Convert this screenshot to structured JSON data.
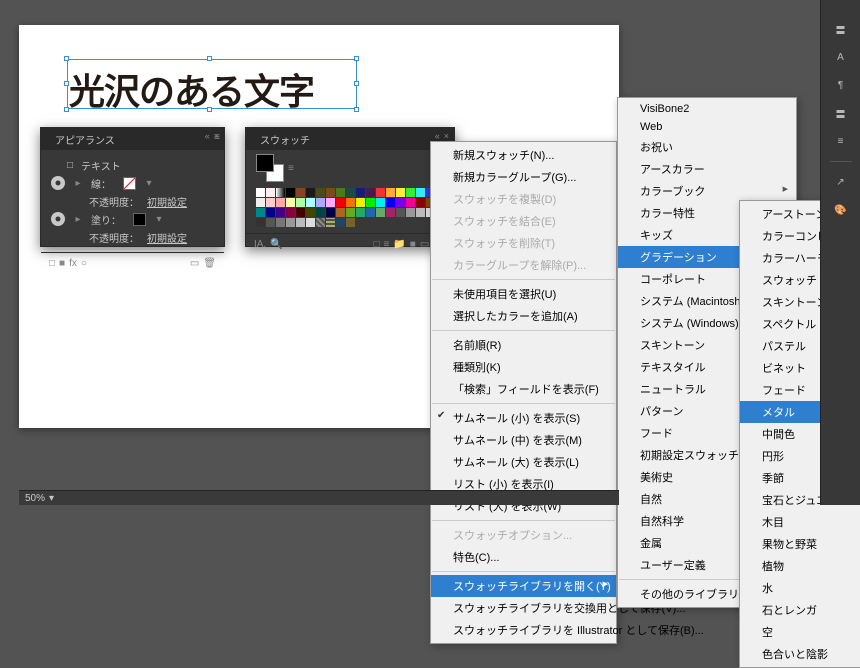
{
  "canvas_text": "光沢のある文字",
  "appearance": {
    "title": "アピアランス",
    "text_mode": "テキスト",
    "rows": [
      {
        "label": "線：",
        "swatch_bg": "linear-gradient(135deg,#fff 45%,#e33 46%,#e33 53%,#fff 54%)"
      },
      {
        "label": "不透明度：",
        "value": "初期設定"
      },
      {
        "label": "塗り：",
        "swatch_bg": "#000"
      },
      {
        "label": "不透明度：",
        "value": "初期設定"
      }
    ],
    "foot_icons": [
      "□",
      "■",
      "fx",
      "○",
      "▭",
      "🗑"
    ]
  },
  "swatches": {
    "title": "スウォッチ",
    "rows": [
      [
        "#fff",
        "#fee",
        "lg",
        "#000",
        "#842",
        "#1a1a1a",
        "#4a4a1a",
        "#7a4a1a",
        "#4a7a1a",
        "#1a4a4a",
        "#1a1a7a",
        "#4a1a4a",
        "#e33",
        "#fa3",
        "#fe3",
        "#3e3",
        "#3ee",
        "#33e",
        "#e3e",
        "#e37"
      ],
      [
        "#eee",
        "#fcc",
        "#faa",
        "#ffa",
        "#afa",
        "#aff",
        "#aaf",
        "#faf",
        "#e00",
        "#e70",
        "#ee0",
        "#0e0",
        "#0ee",
        "#00e",
        "#70e",
        "#e09",
        "#800",
        "#840",
        "#880",
        "#080"
      ],
      [
        "#088",
        "#008",
        "#408",
        "#804",
        "#400",
        "#440",
        "#044",
        "#004",
        "#a62",
        "#6a2",
        "#2a6",
        "#26a",
        "#6a6",
        "#a26",
        "#555",
        "#999",
        "#bbb",
        "#ddd",
        "#000",
        "#fff"
      ],
      [
        "#333",
        "#555",
        "#777",
        "#999",
        "#bbb",
        "#ddd",
        "p1",
        "p2",
        "#246",
        "#762",
        "",
        "",
        "",
        "",
        "",
        "",
        "",
        "",
        "",
        ""
      ]
    ],
    "foot_icons": [
      "IA.",
      "🔍",
      "□",
      "≡",
      "📁",
      "■",
      "▭",
      "🗑"
    ]
  },
  "menu1": {
    "groups": [
      [
        {
          "t": "新規スウォッチ(N)..."
        },
        {
          "t": "新規カラーグループ(G)..."
        },
        {
          "t": "スウォッチを複製(D)",
          "dis": true
        },
        {
          "t": "スウォッチを結合(E)",
          "dis": true
        },
        {
          "t": "スウォッチを削除(T)",
          "dis": true
        },
        {
          "t": "カラーグループを解除(P)...",
          "dis": true
        }
      ],
      [
        {
          "t": "未使用項目を選択(U)"
        },
        {
          "t": "選択したカラーを追加(A)"
        }
      ],
      [
        {
          "t": "名前順(R)"
        },
        {
          "t": "種類別(K)"
        },
        {
          "t": "「検索」フィールドを表示(F)"
        }
      ],
      [
        {
          "t": "サムネール (小) を表示(S)",
          "check": true
        },
        {
          "t": "サムネール (中) を表示(M)"
        },
        {
          "t": "サムネール (大) を表示(L)"
        },
        {
          "t": "リスト (小) を表示(I)"
        },
        {
          "t": "リスト (大) を表示(W)"
        }
      ],
      [
        {
          "t": "スウォッチオプション...",
          "dis": true
        },
        {
          "t": "特色(C)..."
        }
      ],
      [
        {
          "t": "スウォッチライブラリを開く(Y)",
          "hl": true,
          "arrow": true
        },
        {
          "t": "スウォッチライブラリを交換用として保存(V)..."
        },
        {
          "t": "スウォッチライブラリを Illustrator として保存(B)..."
        }
      ]
    ]
  },
  "menu2": {
    "items": [
      {
        "t": "VisiBone2"
      },
      {
        "t": "Web"
      },
      {
        "t": "お祝い"
      },
      {
        "t": "アースカラー"
      },
      {
        "t": "カラーブック",
        "arrow": true
      },
      {
        "t": "カラー特性",
        "arrow": true
      },
      {
        "t": "キッズ"
      },
      {
        "t": "グラデーション",
        "hl": true,
        "arrow": true
      },
      {
        "t": "コーポレート",
        "arrow": true
      },
      {
        "t": "システム (Macintosh)"
      },
      {
        "t": "システム (Windows)"
      },
      {
        "t": "スキントーン"
      },
      {
        "t": "テキスタイル",
        "arrow": true
      },
      {
        "t": "ニュートラル"
      },
      {
        "t": "パターン",
        "arrow": true
      },
      {
        "t": "フード",
        "arrow": true
      },
      {
        "t": "初期設定スウォッチ",
        "arrow": true
      },
      {
        "t": "美術史",
        "arrow": true
      },
      {
        "t": "自然"
      },
      {
        "t": "自然科学",
        "arrow": true
      },
      {
        "t": "金属"
      },
      {
        "t": "ユーザー定義",
        "arrow": true
      },
      {
        "t": "-"
      },
      {
        "t": "その他のライブラリ(O)..."
      }
    ]
  },
  "menu3": {
    "items": [
      {
        "t": "アーストーン"
      },
      {
        "t": "カラーコンビネーション"
      },
      {
        "t": "カラーハーモニー"
      },
      {
        "t": "スウォッチ (明)"
      },
      {
        "t": "スキントーン"
      },
      {
        "t": "スペクトル"
      },
      {
        "t": "パステル"
      },
      {
        "t": "ビネット"
      },
      {
        "t": "フェード"
      },
      {
        "t": "メタル",
        "hl": true
      },
      {
        "t": "中間色"
      },
      {
        "t": "円形"
      },
      {
        "t": "季節"
      },
      {
        "t": "宝石とジュエリー"
      },
      {
        "t": "木目"
      },
      {
        "t": "果物と野菜"
      },
      {
        "t": "植物"
      },
      {
        "t": "水"
      },
      {
        "t": "石とレンガ"
      },
      {
        "t": "空"
      },
      {
        "t": "色合いと陰影"
      }
    ]
  },
  "right_tools": [
    "〓",
    "A",
    "¶",
    "〓",
    "≡",
    "",
    "↗",
    "🎨"
  ],
  "zoom": "50%"
}
